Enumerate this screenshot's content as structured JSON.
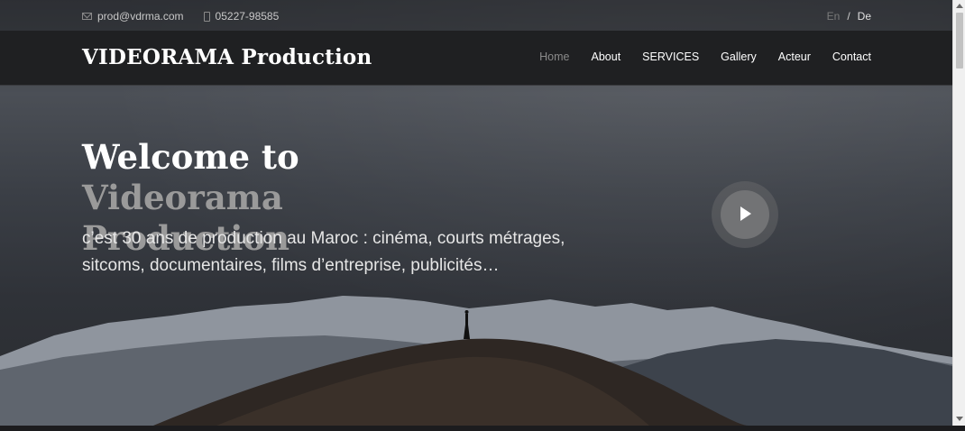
{
  "topbar": {
    "email": "prod@vdrma.com",
    "phone": "05227-98585",
    "lang_en": "En",
    "lang_sep": "/",
    "lang_de": "De"
  },
  "navbar": {
    "logo": "VIDEORAMA Production",
    "menu": [
      {
        "label": "Home",
        "active": true
      },
      {
        "label": "About"
      },
      {
        "label": "SERVICES"
      },
      {
        "label": "Gallery"
      },
      {
        "label": "Acteur"
      },
      {
        "label": "Contact"
      }
    ]
  },
  "hero": {
    "title_white": "Welcome to ",
    "title_gray": "Videorama Production",
    "subtitle": "c’est 30 ans de production au Maroc : cinéma, courts métrages, sitcoms, documentaires, films d’entreprise, publicités…"
  },
  "colors": {
    "accent_gray": "#9a9a9a",
    "navbar_bg": "#1f2022",
    "play_button": "#727375"
  },
  "icons": {
    "email": "envelope-icon",
    "phone": "phone-icon",
    "play": "play-icon"
  }
}
